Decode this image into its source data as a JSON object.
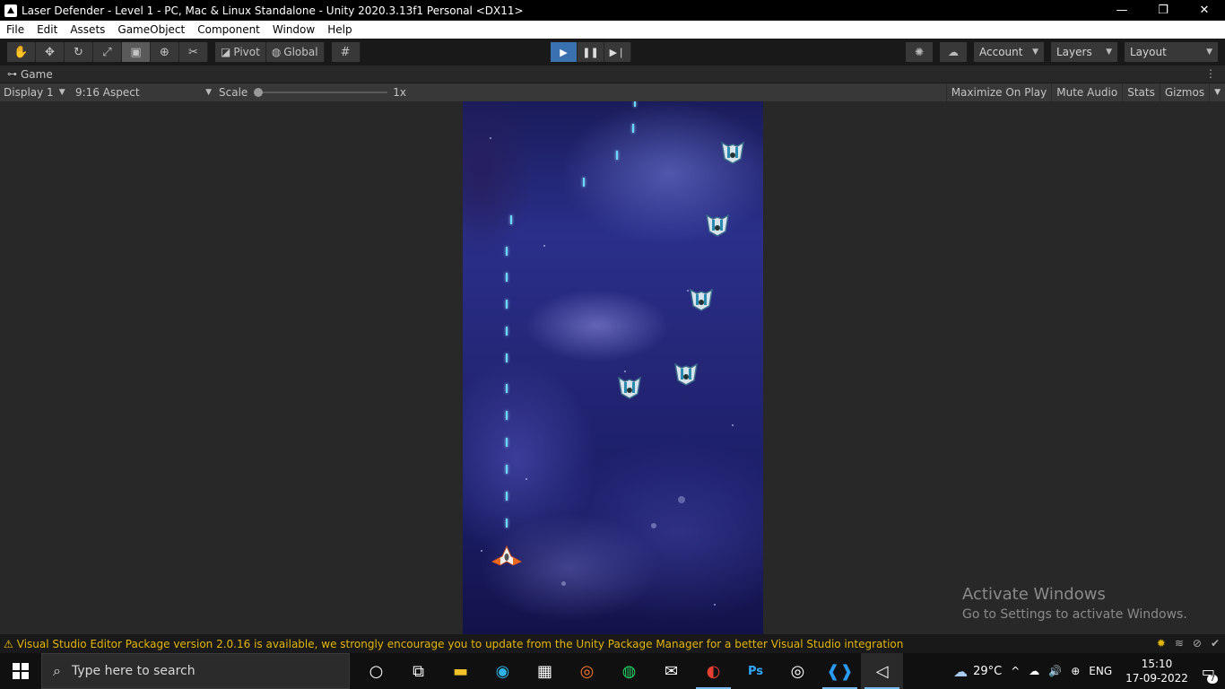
{
  "window": {
    "title": "Laser Defender - Level 1 - PC, Mac & Linux Standalone - Unity 2020.3.13f1 Personal <DX11>",
    "minimize": "—",
    "restore": "❐",
    "close": "✕"
  },
  "menu": [
    "File",
    "Edit",
    "Assets",
    "GameObject",
    "Component",
    "Window",
    "Help"
  ],
  "toolbar": {
    "pivot_label": "Pivot",
    "global_label": "Global",
    "account_label": "Account",
    "layers_label": "Layers",
    "layout_label": "Layout"
  },
  "game_tab": {
    "label": "Game",
    "display": "Display 1",
    "aspect": "9:16 Aspect",
    "scale_label": "Scale",
    "scale_value": "1x",
    "maximize": "Maximize On Play",
    "mute": "Mute Audio",
    "stats": "Stats",
    "gizmos": "Gizmos"
  },
  "activation": {
    "title": "Activate Windows",
    "subtitle": "Go to Settings to activate Windows."
  },
  "status": {
    "message": "Visual Studio Editor Package version 2.0.16 is available, we strongly encourage you to update from the Unity Package Manager for a better Visual Studio integration"
  },
  "taskbar": {
    "search_placeholder": "Type here to search",
    "weather": "29°C",
    "language": "ENG",
    "time": "15:10",
    "date": "17-09-2022",
    "notifications": "7"
  },
  "colors": {
    "play_active": "#3a72b0",
    "warning": "#e2b500",
    "laser": "#6ad8ff"
  }
}
